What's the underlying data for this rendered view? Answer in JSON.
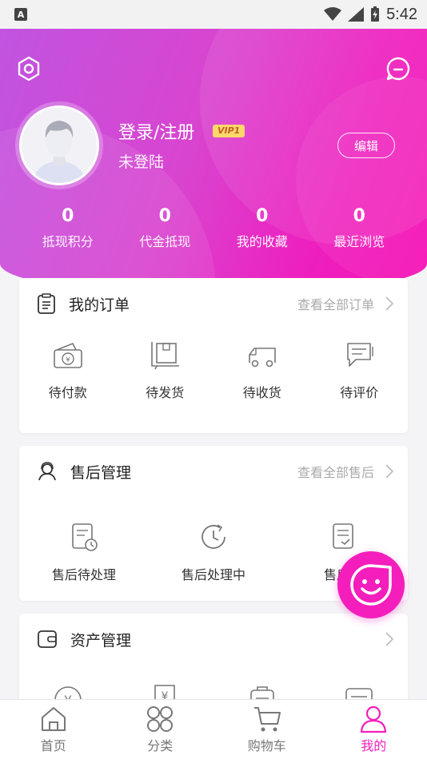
{
  "status_bar": {
    "time": "5:42",
    "notification_icon": "A"
  },
  "header": {
    "login_text": "登录/注册",
    "vip_badge": "VIP1",
    "status_text": "未登陆",
    "edit_label": "编辑",
    "stats": [
      {
        "value": "0",
        "label": "抵现积分"
      },
      {
        "value": "0",
        "label": "代金抵现"
      },
      {
        "value": "0",
        "label": "我的收藏"
      },
      {
        "value": "0",
        "label": "最近浏览"
      }
    ]
  },
  "orders": {
    "title": "我的订单",
    "link": "查看全部订单",
    "items": [
      {
        "label": "待付款",
        "icon": "wallet-icon"
      },
      {
        "label": "待发货",
        "icon": "package-icon"
      },
      {
        "label": "待收货",
        "icon": "truck-icon"
      },
      {
        "label": "待评价",
        "icon": "comment-icon"
      }
    ]
  },
  "after_sales": {
    "title": "售后管理",
    "link": "查看全部售后",
    "items": [
      {
        "label": "售后待处理",
        "icon": "document-clock-icon"
      },
      {
        "label": "售后处理中",
        "icon": "clock-icon"
      },
      {
        "label": "售后已",
        "icon": "document-check-icon"
      }
    ]
  },
  "assets": {
    "title": "资产管理",
    "items": [
      {
        "icon": "yen-circle-icon"
      },
      {
        "icon": "coupon-icon"
      },
      {
        "icon": "bag-icon"
      },
      {
        "icon": "card-icon"
      }
    ]
  },
  "bottom_nav": [
    {
      "label": "首页",
      "icon": "home-icon"
    },
    {
      "label": "分类",
      "icon": "category-icon"
    },
    {
      "label": "购物车",
      "icon": "cart-icon"
    },
    {
      "label": "我的",
      "icon": "user-icon",
      "active": true
    }
  ],
  "colors": {
    "accent": "#f41ebd",
    "gradient_start": "#c054e0",
    "gradient_end": "#f612b3"
  }
}
